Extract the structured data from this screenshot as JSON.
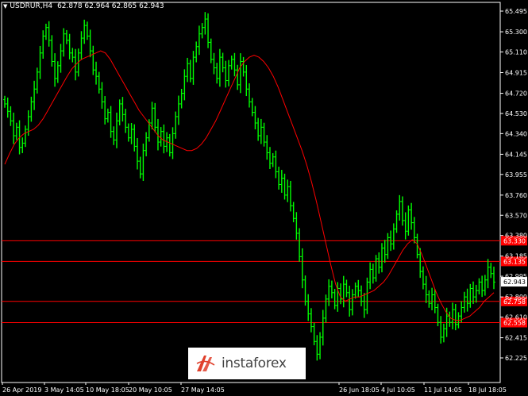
{
  "header": {
    "symbol": "USDRUR,H4",
    "ohlc": "62.878 62.964 62.865 62.943"
  },
  "watermark": {
    "text": "instaforex",
    "icon": "instaforex-logo-icon"
  },
  "colors": {
    "background": "#000000",
    "bar": "#00ff00",
    "ma": "#ff0000",
    "level_line": "#ff0000",
    "level_tag_bg": "#ff0000",
    "price_tag_bg": "#ffffff"
  },
  "chart_data": {
    "type": "line",
    "title": "",
    "xlabel": "",
    "ylabel": "",
    "ylim": [
      62.225,
      65.495
    ],
    "y_ticks": [
      "65.495",
      "65.300",
      "65.110",
      "64.915",
      "64.720",
      "64.530",
      "64.340",
      "64.145",
      "63.955",
      "63.760",
      "63.570",
      "63.380",
      "63.185",
      "62.995",
      "62.800",
      "62.610",
      "62.415",
      "62.225"
    ],
    "x_tick_labels": [
      "26 Apr 2019",
      "3 May 14:05",
      "10 May 18:05",
      "20 May 10:05",
      "27 May 14:05",
      "26 Jun 18:05",
      "4 Jul 10:05",
      "11 Jul 14:05",
      "18 Jul 18:05"
    ],
    "levels": [
      {
        "value": 63.33,
        "label": "63.330"
      },
      {
        "value": 63.135,
        "label": "63.135"
      },
      {
        "value": 62.758,
        "label": "62.758"
      },
      {
        "value": 62.558,
        "label": "62.558"
      }
    ],
    "last_price": {
      "value": 62.943,
      "label": "62.943"
    },
    "series": [
      {
        "name": "",
        "kind": "close-bars",
        "values": [
          64.62,
          64.55,
          64.46,
          64.32,
          64.4,
          64.21,
          64.25,
          64.38,
          64.5,
          64.64,
          64.76,
          64.92,
          65.1,
          65.26,
          65.34,
          65.22,
          65.02,
          64.86,
          64.98,
          65.12,
          65.28,
          65.22,
          65.1,
          65.06,
          64.92,
          65.1,
          65.24,
          65.36,
          65.26,
          65.12,
          64.94,
          64.88,
          64.76,
          64.64,
          64.48,
          64.54,
          64.36,
          64.28,
          64.46,
          64.62,
          64.52,
          64.4,
          64.3,
          64.38,
          64.22,
          64.08,
          63.96,
          64.18,
          64.3,
          64.44,
          64.58,
          64.4,
          64.26,
          64.36,
          64.22,
          64.3,
          64.16,
          64.34,
          64.5,
          64.62,
          64.72,
          64.88,
          65.0,
          64.86,
          65.06,
          65.16,
          65.28,
          65.34,
          65.42,
          65.2,
          65.04,
          64.96,
          64.86,
          65.06,
          64.96,
          64.84,
          64.98,
          65.04,
          64.94,
          64.8,
          65.02,
          64.92,
          64.76,
          64.64,
          64.54,
          64.44,
          64.32,
          64.4,
          64.26,
          64.16,
          64.06,
          64.12,
          63.98,
          63.86,
          63.92,
          63.76,
          63.84,
          63.66,
          63.54,
          63.4,
          63.18,
          62.96,
          62.76,
          62.64,
          62.52,
          62.38,
          62.26,
          62.42,
          62.6,
          62.78,
          62.9,
          62.84,
          62.72,
          62.88,
          62.78,
          62.92,
          62.84,
          62.68,
          62.82,
          62.9,
          62.86,
          62.76,
          62.68,
          62.94,
          63.06,
          62.98,
          63.16,
          63.08,
          63.26,
          63.2,
          63.36,
          63.3,
          63.44,
          63.58,
          63.7,
          63.52,
          63.42,
          63.62,
          63.5,
          63.36,
          63.2,
          63.04,
          62.92,
          62.82,
          62.74,
          62.82,
          62.7,
          62.56,
          62.42,
          62.5,
          62.62,
          62.56,
          62.68,
          62.54,
          62.62,
          62.7,
          62.8,
          62.74,
          62.88,
          62.8,
          62.86,
          62.94,
          62.86,
          62.96,
          63.08,
          63.02,
          62.94
        ]
      },
      {
        "name": "",
        "kind": "moving-average",
        "values": [
          64.05,
          64.15,
          64.24,
          64.3,
          64.34,
          64.36,
          64.38,
          64.42,
          64.48,
          64.56,
          64.64,
          64.72,
          64.8,
          64.88,
          64.95,
          65.0,
          65.04,
          65.06,
          65.08,
          65.1,
          65.12,
          65.1,
          65.04,
          64.96,
          64.88,
          64.8,
          64.72,
          64.64,
          64.56,
          64.5,
          64.44,
          64.38,
          64.32,
          64.28,
          64.26,
          64.24,
          64.22,
          64.2,
          64.18,
          64.18,
          64.2,
          64.24,
          64.3,
          64.38,
          64.46,
          64.56,
          64.66,
          64.76,
          64.86,
          64.96,
          65.02,
          65.06,
          65.08,
          65.06,
          65.02,
          64.96,
          64.88,
          64.78,
          64.66,
          64.54,
          64.42,
          64.3,
          64.18,
          64.04,
          63.88,
          63.7,
          63.5,
          63.3,
          63.1,
          62.92,
          62.8,
          62.76,
          62.78,
          62.8,
          62.8,
          62.82,
          62.84,
          62.86,
          62.9,
          62.94,
          63.0,
          63.08,
          63.16,
          63.24,
          63.3,
          63.34,
          63.3,
          63.2,
          63.08,
          62.96,
          62.84,
          62.74,
          62.66,
          62.6,
          62.58,
          62.58,
          62.6,
          62.62,
          62.66,
          62.7,
          62.76,
          62.8,
          62.84
        ]
      }
    ]
  }
}
